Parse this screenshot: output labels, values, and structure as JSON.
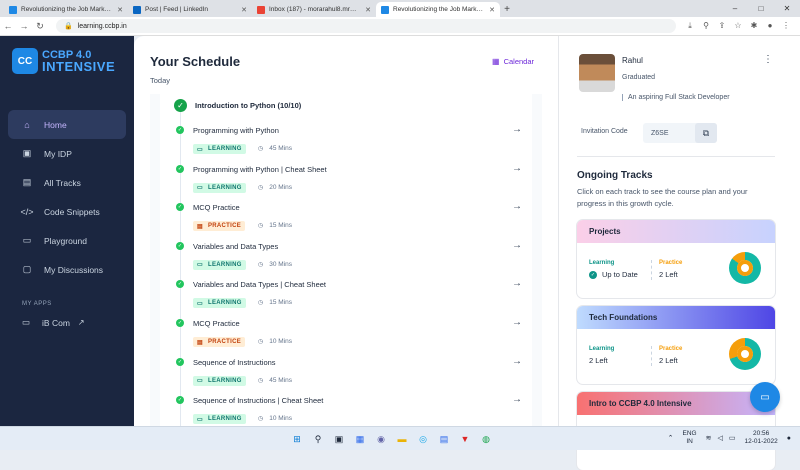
{
  "browser": {
    "tabs": [
      {
        "title": "Revolutionizing the Job Market | N",
        "favicon_color": "#1e88e5",
        "active": false
      },
      {
        "title": "Post | Feed | LinkedIn",
        "favicon_color": "#0a66c2",
        "active": false
      },
      {
        "title": "Inbox (187) - morarahul8.mr@gm",
        "favicon_color": "#ea4335",
        "active": false
      },
      {
        "title": "Revolutionizing the Job Market | N",
        "favicon_color": "#1e88e5",
        "active": true
      }
    ],
    "url": "learning.ccbp.in"
  },
  "sidebar": {
    "logo_line1": "CCBP 4.0",
    "logo_line2": "INTENSIVE",
    "logo_mark": "CC",
    "nav": [
      {
        "label": "Home",
        "icon": "home-icon",
        "glyph": "⌂",
        "active": true
      },
      {
        "label": "My IDP",
        "icon": "idp-icon",
        "glyph": "▣",
        "active": false
      },
      {
        "label": "All Tracks",
        "icon": "tracks-icon",
        "glyph": "▤",
        "active": false
      },
      {
        "label": "Code Snippets",
        "icon": "code-icon",
        "glyph": "</>",
        "active": false
      },
      {
        "label": "Playground",
        "icon": "terminal-icon",
        "glyph": "▭",
        "active": false
      },
      {
        "label": "My Discussions",
        "icon": "discussions-icon",
        "glyph": "▢",
        "active": false
      }
    ],
    "my_apps_label": "MY APPS",
    "ib_com_label": "iB Com"
  },
  "schedule": {
    "title": "Your Schedule",
    "subtitle": "Today",
    "calendar_label": "Calendar",
    "section_title": "Introduction to Python (10/10)",
    "items": [
      {
        "name": "Programming with Python",
        "type": "LEARNING",
        "duration": "45 Mins"
      },
      {
        "name": "Programming with Python | Cheat Sheet",
        "type": "LEARNING",
        "duration": "20 Mins"
      },
      {
        "name": "MCQ Practice",
        "type": "PRACTICE",
        "duration": "15 Mins"
      },
      {
        "name": "Variables and Data Types",
        "type": "LEARNING",
        "duration": "30 Mins"
      },
      {
        "name": "Variables and Data Types | Cheat Sheet",
        "type": "LEARNING",
        "duration": "15 Mins"
      },
      {
        "name": "MCQ Practice",
        "type": "PRACTICE",
        "duration": "10 Mins"
      },
      {
        "name": "Sequence of Instructions",
        "type": "LEARNING",
        "duration": "45 Mins"
      },
      {
        "name": "Sequence of Instructions | Cheat Sheet",
        "type": "LEARNING",
        "duration": "10 Mins"
      }
    ]
  },
  "profile": {
    "name": "Rahul",
    "role": "Graduated",
    "tagline": "An aspiring Full Stack Developer",
    "invitation_label": "Invitation Code",
    "invitation_code": "Z6SE"
  },
  "ongoing": {
    "title": "Ongoing Tracks",
    "description": "Click on each track to see the course plan and your progress in this growth cycle.",
    "learning_label": "Learning",
    "practice_label": "Practice",
    "tracks": [
      {
        "name": "Projects",
        "learning": "Up to Date",
        "practice": "2 Left",
        "header_gradient": [
          "#fbcfe8",
          "#c7d2fe"
        ],
        "learning_done": true,
        "ring_progress": 0.85
      },
      {
        "name": "Tech Foundations",
        "learning": "2 Left",
        "practice": "2 Left",
        "header_gradient": [
          "#bfdbfe",
          "#4f46e5"
        ],
        "learning_done": false,
        "ring_progress": 0.7
      },
      {
        "name": "Intro to CCBP 4.0 Intensive",
        "header_gradient": [
          "#f87171",
          "#c4b5fd"
        ]
      }
    ]
  },
  "colors": {
    "accent": "#6d28d9",
    "learning": "#0d9488",
    "practice": "#f59e0b",
    "ring_teal": "#14b8a6",
    "ring_orange": "#f59e0b"
  },
  "taskbar": {
    "lang_line1": "ENG",
    "lang_line2": "IN",
    "time": "20:56",
    "date": "12-01-2022"
  }
}
